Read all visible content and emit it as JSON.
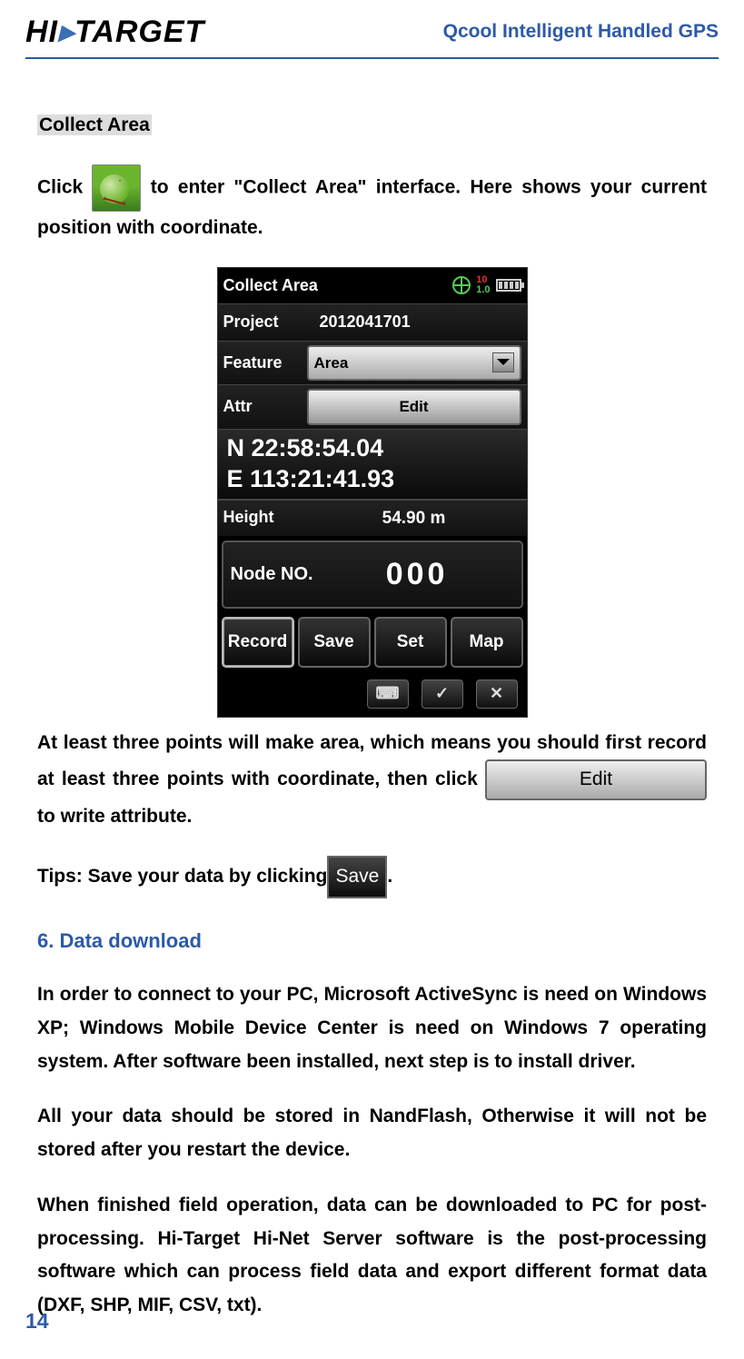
{
  "header": {
    "logo_text": "HI▸TARGET",
    "title": "Qcool Intelligent Handled GPS"
  },
  "section": {
    "collect_area_title": "Collect Area",
    "para1_a": "Click ",
    "para1_b": " to enter \"Collect Area\" interface. Here shows your current position with coordinate.",
    "para2_a": "At least three points will make area, which means you should first record at least three points with coordinate, then click ",
    "edit_chip": "Edit",
    "para2_b": " to write attribute.",
    "tips_a": "Tips: Save your data by clicking",
    "save_chip": "Save",
    "tips_b": ".",
    "heading6": "6.  Data download",
    "dl_para1": "In order to connect to your PC, Microsoft ActiveSync is need on Windows XP; Windows Mobile Device Center is need on Windows 7 operating system. After software been installed, next step is to install driver.",
    "dl_para2": "All your data should be stored in NandFlash, Otherwise it will not be stored after you restart the device.",
    "dl_para3": "When finished field operation, data can be downloaded to PC for post-processing. Hi-Target Hi-Net Server software is the post-processing software which can process field data and export different format data (DXF, SHP, MIF, CSV, txt)."
  },
  "device": {
    "title": "Collect Area",
    "gps_top": "10",
    "gps_bot": "1.0",
    "project_label": "Project",
    "project_value": "2012041701",
    "feature_label": "Feature",
    "feature_value": "Area",
    "attr_label": "Attr",
    "attr_edit": "Edit",
    "coord_n": "N  22:58:54.04",
    "coord_e": "E 113:21:41.93",
    "height_label": "Height",
    "height_value": "54.90 m",
    "node_label": "Node NO.",
    "node_value": "000",
    "buttons": {
      "record": "Record",
      "save": "Save",
      "set": "Set",
      "map": "Map"
    },
    "icons": {
      "kbd": "⌨",
      "ok": "✓",
      "close": "✕"
    }
  },
  "page_number": "14"
}
